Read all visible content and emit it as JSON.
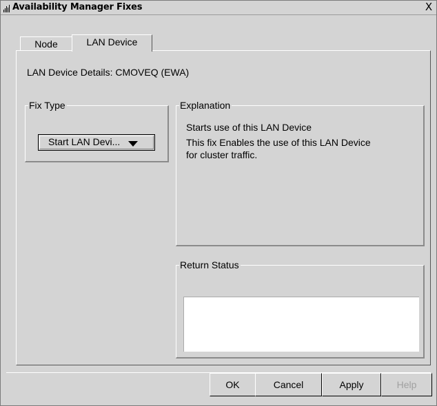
{
  "window": {
    "title": "Availability Manager Fixes",
    "close_glyph": "X",
    "app_icon": "bar-chart-icon"
  },
  "tabs": [
    {
      "label": "Node",
      "selected": false
    },
    {
      "label": "LAN Device",
      "selected": true
    }
  ],
  "details_text": "LAN Device Details: CMOVEQ (EWA)",
  "fix_type": {
    "group_label": "Fix Type",
    "selected_value": "Start LAN Devi...",
    "arrow_icon": "triangle-down-icon"
  },
  "explanation": {
    "group_label": "Explanation",
    "lines": [
      "Starts use of this LAN Device",
      "This fix Enables the use of this LAN Device",
      "for cluster traffic."
    ]
  },
  "return_status": {
    "group_label": "Return Status",
    "value": ""
  },
  "buttons": {
    "ok": "OK",
    "cancel": "Cancel",
    "apply": "Apply",
    "help": "Help"
  },
  "colors": {
    "background": "#d4d4d4",
    "disabled_text": "#a0a0a0",
    "status_background": "#ffffff"
  }
}
